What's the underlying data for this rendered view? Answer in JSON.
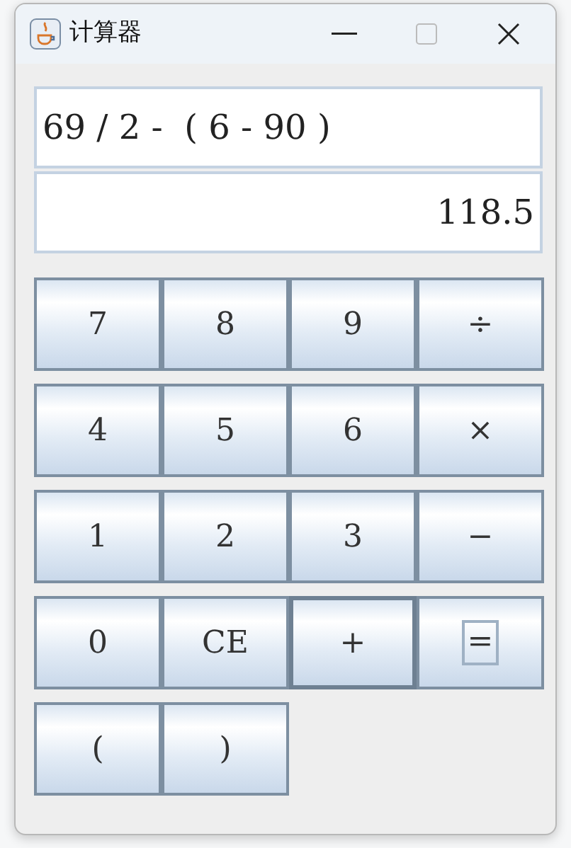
{
  "window": {
    "title": "计算器"
  },
  "expression": {
    "value": "69 / 2 -  ( 6 - 90 )"
  },
  "result": {
    "value": "118.5"
  },
  "keys": [
    [
      {
        "label": "7",
        "pressed": false,
        "focused": false
      },
      {
        "label": "8",
        "pressed": false,
        "focused": false
      },
      {
        "label": "9",
        "pressed": false,
        "focused": false
      },
      {
        "label": "÷",
        "pressed": false,
        "focused": false
      }
    ],
    [
      {
        "label": "4",
        "pressed": false,
        "focused": false
      },
      {
        "label": "5",
        "pressed": false,
        "focused": false
      },
      {
        "label": "6",
        "pressed": false,
        "focused": false
      },
      {
        "label": "×",
        "pressed": false,
        "focused": false
      }
    ],
    [
      {
        "label": "1",
        "pressed": false,
        "focused": false
      },
      {
        "label": "2",
        "pressed": false,
        "focused": false
      },
      {
        "label": "3",
        "pressed": false,
        "focused": false
      },
      {
        "label": "−",
        "pressed": false,
        "focused": false
      }
    ],
    [
      {
        "label": "0",
        "pressed": false,
        "focused": false
      },
      {
        "label": "CE",
        "pressed": false,
        "focused": false
      },
      {
        "label": "+",
        "pressed": true,
        "focused": false
      },
      {
        "label": "=",
        "pressed": false,
        "focused": true
      }
    ],
    [
      {
        "label": "(",
        "pressed": false,
        "focused": false
      },
      {
        "label": ")",
        "pressed": false,
        "focused": false
      }
    ]
  ]
}
